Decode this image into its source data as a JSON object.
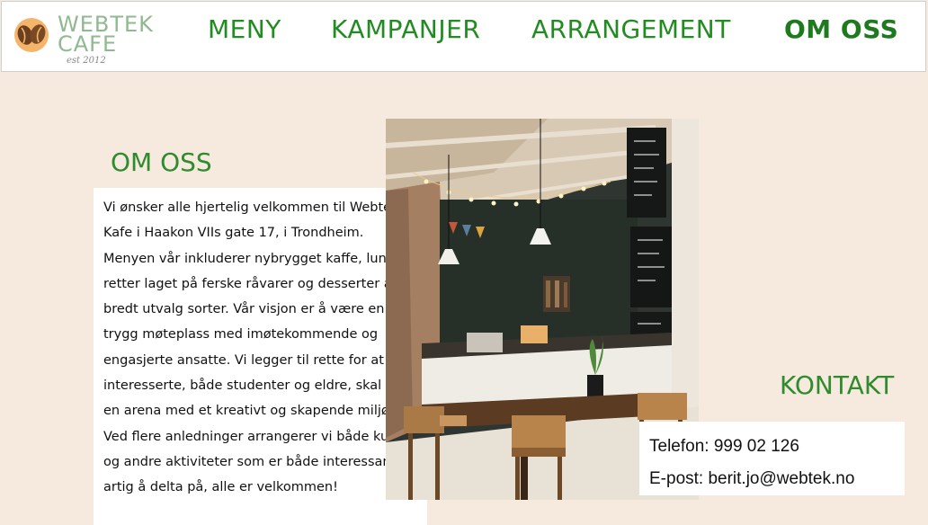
{
  "logo": {
    "line1": "WEBTEK",
    "line2": "CAFE",
    "est": "est 2012"
  },
  "nav": {
    "items": [
      {
        "label": "MENY"
      },
      {
        "label": "KAMPANJER"
      },
      {
        "label": "ARRANGEMENT"
      },
      {
        "label": "OM OSS"
      }
    ]
  },
  "about": {
    "title": "OM OSS",
    "text": "Vi ønsker alle hjertelig velkommen til Webtek Kafe i Haakon VIIs gate 17, i Trondheim. Menyen vår inkluderer nybrygget kaffe, lunch-retter laget på ferske råvarer og desserter av et bredt utvalg sorter. Vår visjon er å være en trygg møteplass med imøtekommende og engasjerte ansatte. Vi legger til rette for at IT-interesserte, både studenter og eldre, skal ha en arena med et kreativt og skapende miljø. Ved flere anledninger arrangerer vi både kurs og andre aktiviteter som er både interessant og artig å delta på, alle er velkommen!"
  },
  "contact": {
    "title": "KONTAKT",
    "phone": "Telefon: 999 02 126",
    "email": "E-post: berit.jo@webtek.no"
  },
  "colors": {
    "page_background": "#f6e9dd",
    "accent_green": "#228b22",
    "logo_green": "#8fb98f"
  }
}
